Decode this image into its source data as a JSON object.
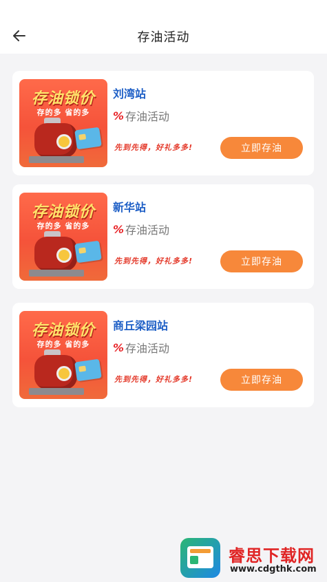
{
  "header": {
    "title": "存油活动",
    "back_icon": "arrow-left-icon"
  },
  "stations": [
    {
      "name": "刘湾站",
      "thumb_title": "存油锁价",
      "thumb_sub": "存的多 省的多",
      "tag_icon": "%",
      "tag_text": "存油活动",
      "slogan": "先到先得，好礼多多!",
      "button": "立即存油"
    },
    {
      "name": "新华站",
      "thumb_title": "存油锁价",
      "thumb_sub": "存的多 省的多",
      "tag_icon": "%",
      "tag_text": "存油活动",
      "slogan": "先到先得，好礼多多!",
      "button": "立即存油"
    },
    {
      "name": "商丘梁园站",
      "thumb_title": "存油锁价",
      "thumb_sub": "存的多 省的多",
      "tag_icon": "%",
      "tag_text": "存油活动",
      "slogan": "先到先得，好礼多多!",
      "button": "立即存油"
    }
  ],
  "watermark": {
    "name": "睿思下载网",
    "url": "www.cdgthk.com"
  },
  "colors": {
    "accent": "#f7883a",
    "station_name": "#1e5fc6",
    "slogan": "#e43a2b"
  }
}
